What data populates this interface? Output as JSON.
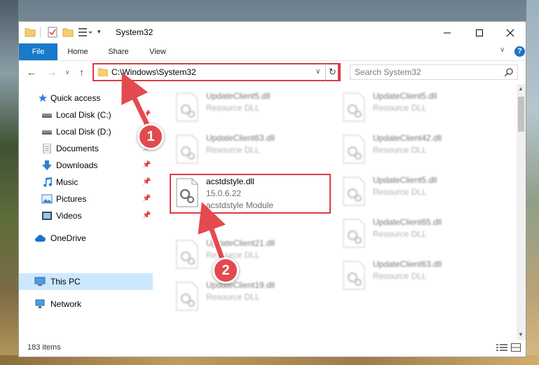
{
  "window": {
    "title": "System32",
    "quick_access_dropdown": "▾"
  },
  "ribbon": {
    "tabs": [
      {
        "label": "File"
      },
      {
        "label": "Home"
      },
      {
        "label": "Share"
      },
      {
        "label": "View"
      }
    ],
    "help": "?"
  },
  "nav": {
    "address": "C:\\Windows\\System32",
    "search_placeholder": "Search System32"
  },
  "sidebar": {
    "items": [
      {
        "label": "Quick access",
        "icon": "star-icon",
        "pinned": false
      },
      {
        "label": "Local Disk (C:)",
        "icon": "drive-icon",
        "pinned": true
      },
      {
        "label": "Local Disk (D:)",
        "icon": "drive-icon",
        "pinned": false
      },
      {
        "label": "Documents",
        "icon": "documents-icon",
        "pinned": true
      },
      {
        "label": "Downloads",
        "icon": "download-arrow-icon",
        "pinned": true
      },
      {
        "label": "Music",
        "icon": "music-note-icon",
        "pinned": true
      },
      {
        "label": "Pictures",
        "icon": "pictures-icon",
        "pinned": true
      },
      {
        "label": "Videos",
        "icon": "videos-icon",
        "pinned": true
      },
      {
        "label": "OneDrive",
        "icon": "cloud-icon",
        "pinned": false
      },
      {
        "label": "This PC",
        "icon": "computer-icon",
        "pinned": false,
        "selected": true
      },
      {
        "label": "Network",
        "icon": "network-icon",
        "pinned": false
      }
    ]
  },
  "files": {
    "left": [
      {
        "name": "UpdateClient5.dll",
        "meta1": "Resource DLL",
        "meta2": ""
      },
      {
        "name": "UpdateClient63.dll",
        "meta1": "Resource DLL",
        "meta2": ""
      },
      {
        "name": "acstdstyle.dll",
        "meta1": "15.0.6.22",
        "meta2": "acstdstyle Module",
        "highlighted": true
      },
      {
        "name": "UpdateClient21.dll",
        "meta1": "Resource DLL",
        "meta2": ""
      },
      {
        "name": "UpdateClient19.dll",
        "meta1": "Resource DLL",
        "meta2": ""
      }
    ],
    "right": [
      {
        "name": "UpdateClient5.dll",
        "meta1": "Resource DLL"
      },
      {
        "name": "UpdateClient42.dll",
        "meta1": "Resource DLL"
      },
      {
        "name": "UpdateClient5.dll",
        "meta1": "Resource DLL"
      },
      {
        "name": "UpdateClient65.dll",
        "meta1": "Resource DLL"
      },
      {
        "name": "UpdateClient63.dll",
        "meta1": "Resource DLL"
      }
    ]
  },
  "status": {
    "item_count": "183 items"
  },
  "callouts": {
    "one": "1",
    "two": "2"
  },
  "colors": {
    "accent": "#1979ca",
    "highlight_red": "#dd3a44",
    "callout_red": "#e34a4f",
    "selected_bg": "#cce8ff"
  }
}
